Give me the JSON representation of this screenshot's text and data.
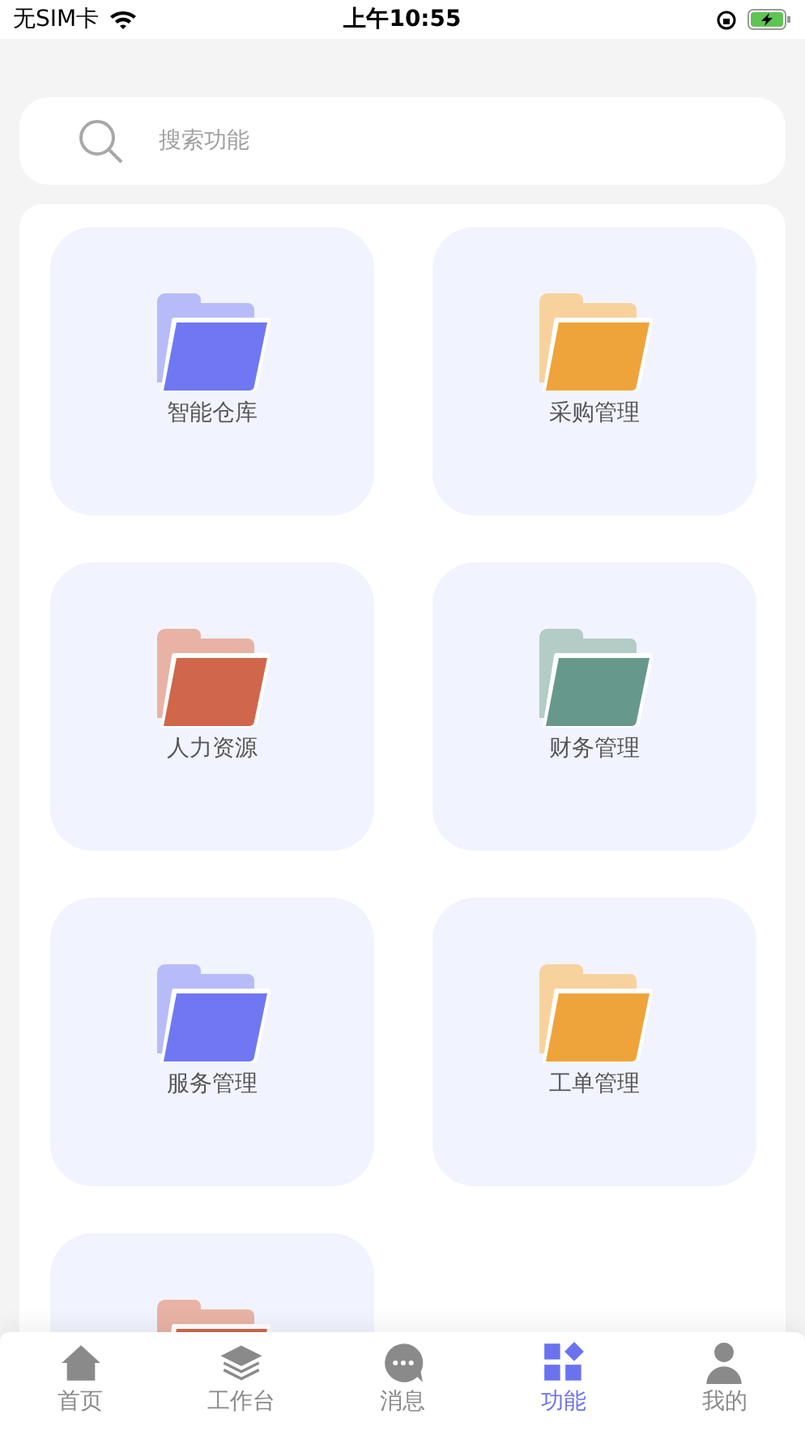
{
  "status_bar": {
    "carrier": "无SIM卡",
    "time": "上午10:55"
  },
  "search": {
    "placeholder": "搜索功能"
  },
  "modules": [
    {
      "label": "智能仓库",
      "color": "#6f78f2"
    },
    {
      "label": "采购管理",
      "color": "#eea43a"
    },
    {
      "label": "人力资源",
      "color": "#d0664a"
    },
    {
      "label": "财务管理",
      "color": "#66998c"
    },
    {
      "label": "服务管理",
      "color": "#6f78f2"
    },
    {
      "label": "工单管理",
      "color": "#eea43a"
    },
    {
      "color": "#d0664a"
    }
  ],
  "tab_bar": [
    {
      "label": "首页",
      "kind": "home",
      "selected": false
    },
    {
      "label": "工作台",
      "kind": "layers",
      "selected": false
    },
    {
      "label": "消息",
      "kind": "chat",
      "selected": false
    },
    {
      "label": "功能",
      "kind": "grid",
      "selected": true
    },
    {
      "label": "我的",
      "kind": "person",
      "selected": false
    }
  ]
}
